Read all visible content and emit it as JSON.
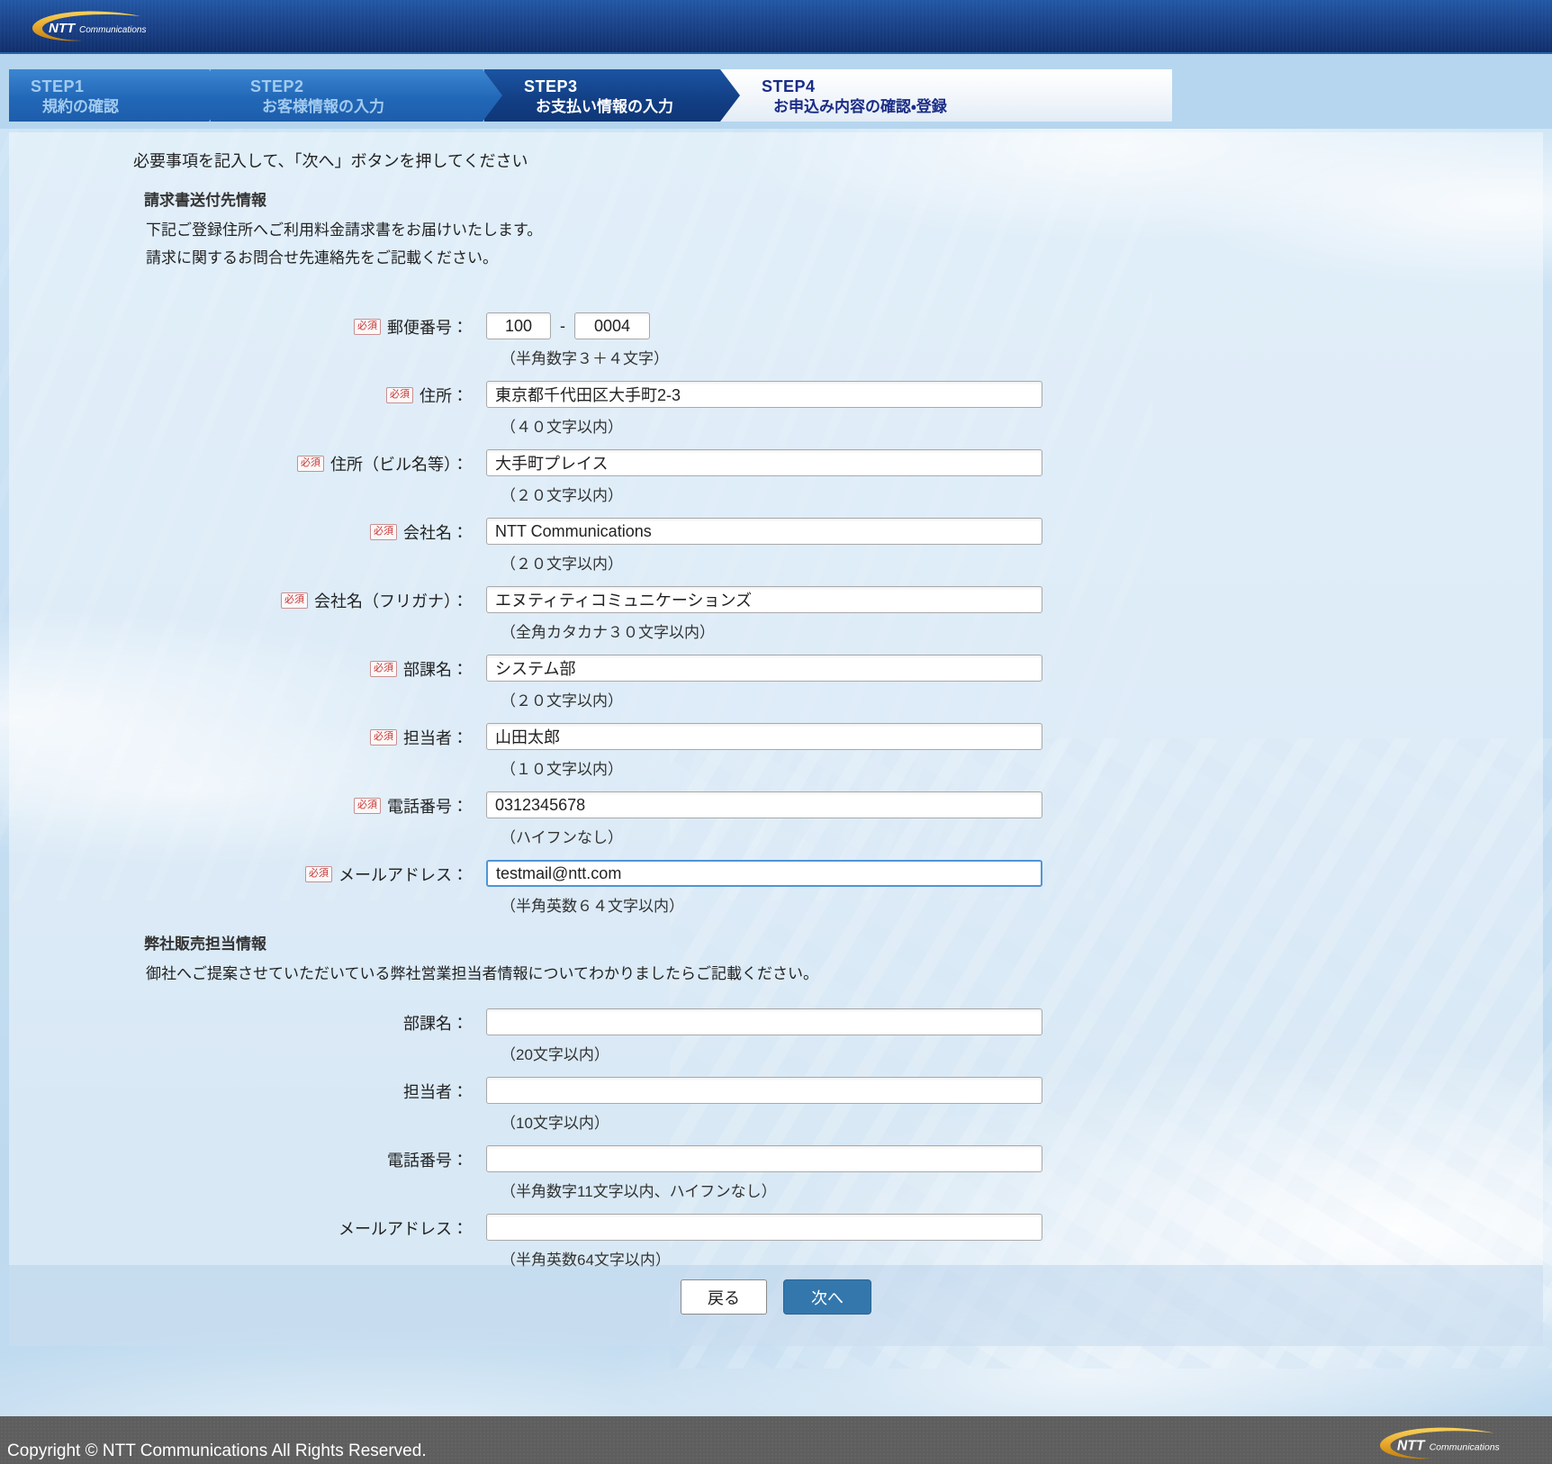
{
  "brand": {
    "bold": "NTT",
    "rest": "Communications"
  },
  "steps": [
    {
      "step": "STEP1",
      "label": "規約の確認",
      "state": "done"
    },
    {
      "step": "STEP2",
      "label": "お客様情報の入力",
      "state": "done"
    },
    {
      "step": "STEP3",
      "label": "お支払い情報の入力",
      "state": "active"
    },
    {
      "step": "STEP4",
      "label": "お申込み内容の確認・登録",
      "state": "upcoming"
    }
  ],
  "labels": {
    "required": "必須"
  },
  "instruction": "必要事項を記入して、「次へ」ボタンを押してください",
  "billing": {
    "title": "請求書送付先情報",
    "desc1": "下記ご登録住所へご利用料金請求書をお届けいたします。",
    "desc2": "請求に関するお問合せ先連絡先をご記載ください。",
    "postal": {
      "label": "郵便番号：",
      "value1": "100",
      "separator": "-",
      "value2": "0004",
      "hint": "（半角数字３＋４文字）",
      "required": true
    },
    "fields": [
      {
        "label": "住所：",
        "value": "東京都千代田区大手町2-3",
        "hint": "（４０文字以内）",
        "required": true
      },
      {
        "label": "住所（ビル名等）：",
        "value": "大手町プレイス",
        "hint": "（２０文字以内）",
        "required": true
      },
      {
        "label": "会社名：",
        "value": "NTT Communications",
        "hint": "（２０文字以内）",
        "required": true
      },
      {
        "label": "会社名（フリガナ）：",
        "value": "エヌティティコミュニケーションズ",
        "hint": "（全角カタカナ３０文字以内）",
        "required": true
      },
      {
        "label": "部課名：",
        "value": "システム部",
        "hint": "（２０文字以内）",
        "required": true
      },
      {
        "label": "担当者：",
        "value": "山田太郎",
        "hint": "（１０文字以内）",
        "required": true
      },
      {
        "label": "電話番号：",
        "value": "0312345678",
        "hint": "（ハイフンなし）",
        "required": true
      },
      {
        "label": "メールアドレス：",
        "value": "testmail@ntt.com",
        "hint": "（半角英数６４文字以内）",
        "required": true,
        "focused": true
      }
    ]
  },
  "sales": {
    "title": "弊社販売担当情報",
    "desc": "御社へご提案させていただいている弊社営業担当者情報についてわかりましたらご記載ください。",
    "fields": [
      {
        "label": "部課名：",
        "value": "",
        "hint": "（20文字以内）"
      },
      {
        "label": "担当者：",
        "value": "",
        "hint": "（10文字以内）"
      },
      {
        "label": "電話番号：",
        "value": "",
        "hint": "（半角数字11文字以内、ハイフンなし）"
      },
      {
        "label": "メールアドレス：",
        "value": "",
        "hint": "（半角英数64文字以内）"
      }
    ]
  },
  "buttons": {
    "back": "戻る",
    "next": "次へ"
  },
  "footer": {
    "copyright": "Copyright © NTT Communications All Rights Reserved."
  },
  "colors": {
    "header_navy": "#16377a",
    "step_active_bg": "#123e84",
    "step_inactive_bg": "#2268b8",
    "step_next_text": "#1a2c86",
    "band_blue": "#b5d6ee",
    "accent_button": "#3377ad",
    "required_red": "#c43434",
    "footer_gray": "#5e5e5e",
    "focus_border": "#4f94d6"
  }
}
